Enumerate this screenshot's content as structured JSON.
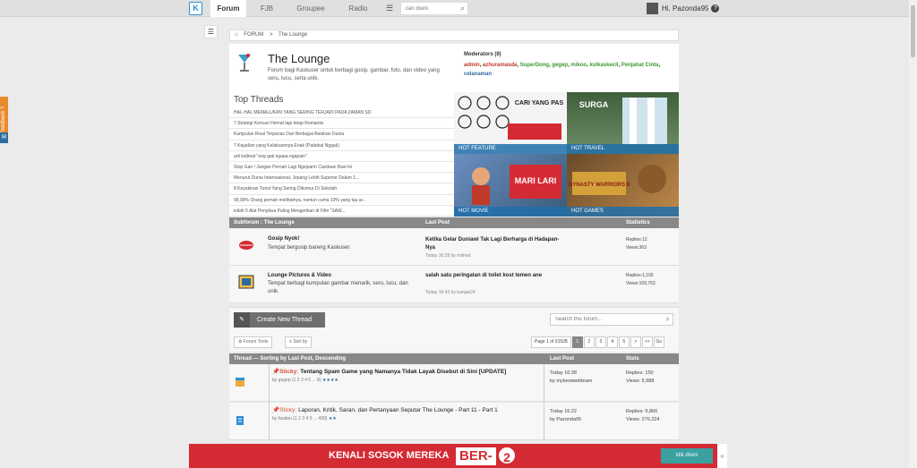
{
  "topbar": {
    "logo": "K",
    "tabs": [
      {
        "label": "Forum",
        "active": true
      },
      {
        "label": "FJB",
        "active": false
      },
      {
        "label": "Groupee",
        "active": false
      },
      {
        "label": "Radio",
        "active": false
      }
    ],
    "search_placeholder": "cari disini",
    "user": "Hi, Pazonda95"
  },
  "feedback": "Feedback ?",
  "breadcrumb": {
    "home_icon": "home-icon",
    "items": [
      "FORUM",
      ">",
      "The Lounge"
    ]
  },
  "forum": {
    "title": "The Lounge",
    "description": "Forum bagi Kaskuser untuk berbagi gosip, gambar, foto, dan video yang seru, lucu, serta unik.",
    "moderators_title": "Moderators (8)",
    "moderators_red": [
      "admin",
      "azhuramasda"
    ],
    "moderators_green": [
      "SuperDong",
      "gegep",
      "mikoo",
      "kulkaskecil",
      "Penjahat Cinta"
    ],
    "moderators_blue": [
      "celanaman"
    ]
  },
  "top_threads": {
    "title": "Top Threads",
    "items": [
      "HAL-HAL MEMALUKAN YANG SERING TERJADI PADA ZAMAN SD",
      "7 Strategi Kencan Hemat tapi tetap Romantis",
      "Kumpulan Rival Terpanas Dari Berbagai Belahan Dunia",
      "7 Kejadian yang Kelakuannya Enak (Padahal Nggak)",
      "arti kalimat \"eeg gak ngapa-ngapain\"",
      "Stop Gan ! Jangan Pernah Lagi Ngejuarin Candaan Basi Ini",
      "Menurut Dunia Internasional, Jepang Lebih Superior Dalam 1...",
      "8 Keyakinan Turist Yang Sering Dikomur Di Sekolah",
      "99,99% Orang pernah melihatnya, namun cuma 10% yang tau ar...",
      "inilah 5 Alat Penyiksa Paling Mengerikan di Film \"SAW..."
    ]
  },
  "tiles": [
    {
      "label": "HOT FEATURE",
      "art": "CARI YANG PAS"
    },
    {
      "label": "HOT TRAVEL",
      "art": "SURGA"
    },
    {
      "label": "HOT MOVIE",
      "art": "MARI LARI"
    },
    {
      "label": "HOT GAMES",
      "art": "DYNASTY WARRIORS 8"
    }
  ],
  "subforum_head": {
    "col1": "Subforum : The Lounge",
    "col2": "Last Post",
    "col3": "Statistics"
  },
  "subforums": [
    {
      "name": "Gosip Nyok!",
      "desc": "Tempat bergosip bareng Kaskuser.",
      "last_post": "Ketika Gelar Duniawi Tak Lagi Berharga di Hadapan-Nya",
      "last_time": "Today 16:39 by nofried",
      "replies": "Replies:12",
      "views": "Views:363"
    },
    {
      "name": "Lounge Pictures & Video",
      "desc": "Tempat berbagi kumpulan gambar menarik, seru, lucu, dan unik.",
      "last_post": "salah satu peringatan di toilet kost temen ane",
      "last_time": "Today 16:42 by banjak24",
      "replies": "Replies:1,100",
      "views": "Views:109,763"
    }
  ],
  "toolbar": {
    "create": "Create New Thread",
    "search_placeholder": "Search this forum...",
    "forum_tools": "Forum Tools",
    "sort_by": "Sort by",
    "page_label": "Page 1 of 31528",
    "pages": [
      "1",
      "2",
      "3",
      "4",
      "5",
      ">",
      ">>",
      "Go"
    ]
  },
  "thread_head": {
    "col1": "Thread — Sorting by Last Post, Descending",
    "col2": "Last Post",
    "col3": "Stats"
  },
  "threads": [
    {
      "sticky": "Sticky:",
      "title": "Tentang Spam Game yang Namanya Tidak Layak Disebut di Sini [UPDATE]",
      "meta": "by gegep  (1 2 3 4 5 ... 8)",
      "stars": "★★★★",
      "last_time": "Today 16:28",
      "last_by": "by mybestwebteam",
      "replies": "Replies: 150",
      "views": "Views: 5,988"
    },
    {
      "sticky": "Sticky:",
      "title": "Laporan, Kritik, Saran, dan Pertanyaan Seputar The Lounge - Part 11 - Part 1",
      "meta": "by faudeu  (1 2 3 4 5 ... 499)",
      "stars": "★★",
      "last_time": "Today 16:22",
      "last_by": "by Pazonda95",
      "replies": "Replies: 9,866",
      "views": "Views: 276,224"
    }
  ],
  "ad": {
    "text": "KENALI SOSOK MEREKA",
    "ber": "BER-",
    "num": "2",
    "cta": "klik disini",
    "close": "«"
  }
}
